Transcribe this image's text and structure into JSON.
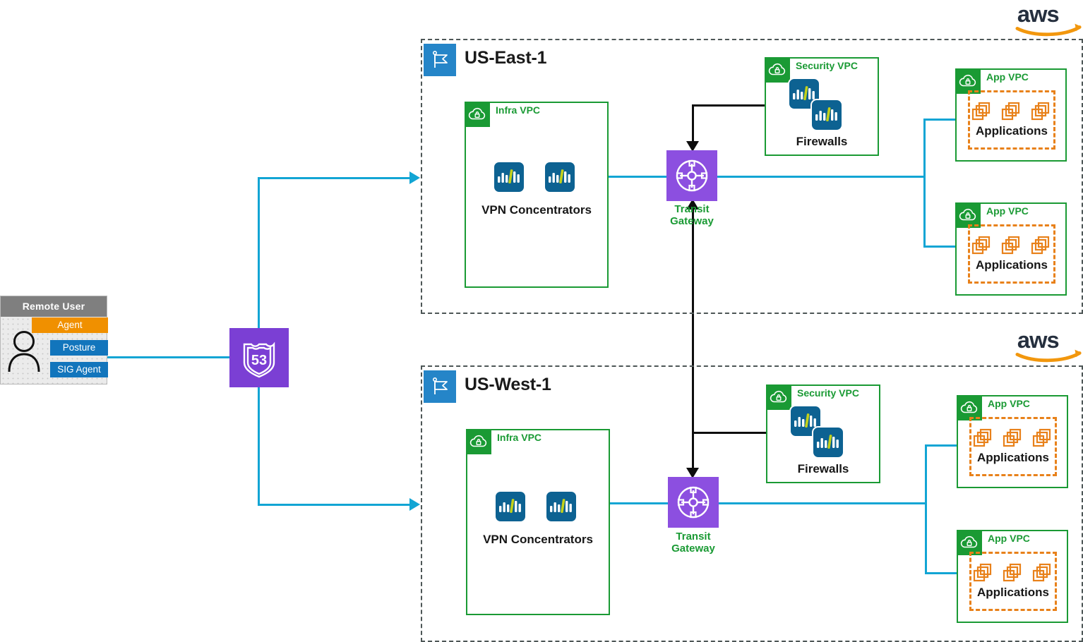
{
  "diagram": {
    "title": "AWS Multi-Region Remote Access Architecture",
    "colors": {
      "cyan_link": "#12a5d4",
      "black_link": "#0d0d0d",
      "vpc_green": "#1a9a34",
      "region_dash": "#4d5656",
      "transit_purple": "#8c4fe0",
      "route53_purple": "#7b3fd4",
      "apps_orange": "#e8811a",
      "flag_blue": "#2585c8",
      "cisco_blue": "#0d6292",
      "aws_navy": "#252f3e",
      "aws_orange": "#f2970d",
      "agent_orange": "#f09000",
      "posture_blue": "#1275bc",
      "header_gray": "#7f7f7f"
    }
  },
  "remote_user": {
    "title": "Remote User",
    "avatar_icon": "person-icon",
    "pills": [
      {
        "label": "Agent",
        "style": "agent"
      },
      {
        "label": "Posture",
        "style": "posture"
      },
      {
        "label": "SIG Agent",
        "style": "sig"
      }
    ]
  },
  "route53": {
    "icon": "route53-shield-icon",
    "shield_number": "53"
  },
  "cloud_logos": [
    {
      "name": "aws-logo-top",
      "text": "aws"
    },
    {
      "name": "aws-logo-bottom",
      "text": "aws"
    }
  ],
  "regions": [
    {
      "id": "us-east-1",
      "label": "US-East-1",
      "flag_icon": "region-flag-icon",
      "infra_vpc": {
        "label": "Infra VPC",
        "icon": "vpc-cloud-lock-icon",
        "devices": {
          "count": 2,
          "icon": "cisco-device-icon",
          "caption": "VPN Concentrators"
        }
      },
      "security_vpc": {
        "label": "Security VPC",
        "icon": "vpc-cloud-lock-icon",
        "devices": {
          "count": 2,
          "icon": "cisco-device-icon",
          "caption": "Firewalls"
        }
      },
      "transit_gateway": {
        "label_line1": "Transit",
        "label_line2": "Gateway",
        "icon": "transit-gateway-icon"
      },
      "app_vpcs": [
        {
          "label": "App VPC",
          "icon": "vpc-cloud-lock-icon",
          "apps_label": "Applications",
          "app_groups": 3
        },
        {
          "label": "App VPC",
          "icon": "vpc-cloud-lock-icon",
          "apps_label": "Applications",
          "app_groups": 3
        }
      ]
    },
    {
      "id": "us-west-1",
      "label": "US-West-1",
      "flag_icon": "region-flag-icon",
      "infra_vpc": {
        "label": "Infra VPC",
        "icon": "vpc-cloud-lock-icon",
        "devices": {
          "count": 2,
          "icon": "cisco-device-icon",
          "caption": "VPN Concentrators"
        }
      },
      "security_vpc": {
        "label": "Security VPC",
        "icon": "vpc-cloud-lock-icon",
        "devices": {
          "count": 2,
          "icon": "cisco-device-icon",
          "caption": "Firewalls"
        }
      },
      "transit_gateway": {
        "label_line1": "Transit",
        "label_line2": "Gateway",
        "icon": "transit-gateway-icon"
      },
      "app_vpcs": [
        {
          "label": "App VPC",
          "icon": "vpc-cloud-lock-icon",
          "apps_label": "Applications",
          "app_groups": 3
        },
        {
          "label": "App VPC",
          "icon": "vpc-cloud-lock-icon",
          "apps_label": "Applications",
          "app_groups": 3
        }
      ]
    }
  ]
}
